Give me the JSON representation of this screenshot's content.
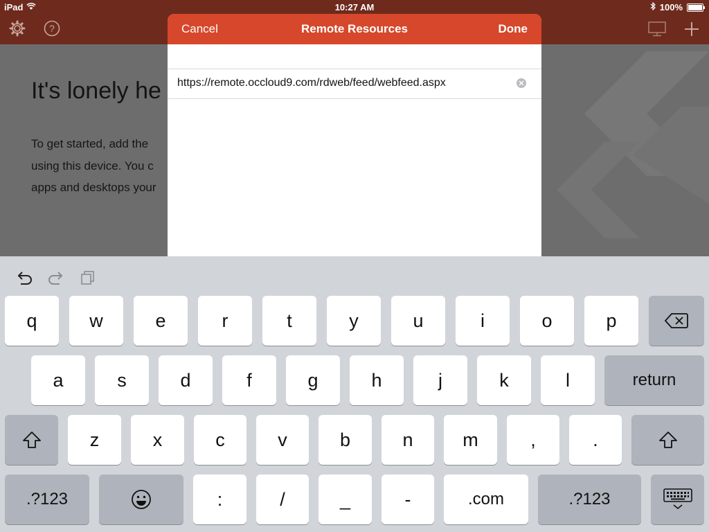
{
  "status_bar": {
    "device": "iPad",
    "time": "10:27 AM",
    "battery": "100%"
  },
  "app_header": {
    "icons": [
      "gear-icon",
      "help-icon",
      "desktop-icon",
      "plus-icon"
    ]
  },
  "background": {
    "heading": "It's lonely he",
    "lines": [
      "To get started, add the",
      "using this device. You c",
      "apps and desktops your"
    ]
  },
  "modal": {
    "cancel_label": "Cancel",
    "title": "Remote Resources",
    "done_label": "Done",
    "url_value": "https://remote.occloud9.com/rdweb/feed/webfeed.aspx"
  },
  "keyboard": {
    "tools": [
      "undo-icon",
      "redo-icon",
      "paste-icon"
    ],
    "row1": [
      "q",
      "w",
      "e",
      "r",
      "t",
      "y",
      "u",
      "i",
      "o",
      "p"
    ],
    "row2": [
      "a",
      "s",
      "d",
      "f",
      "g",
      "h",
      "j",
      "k",
      "l"
    ],
    "row3": [
      "z",
      "x",
      "c",
      "v",
      "b",
      "n",
      "m",
      ",",
      "."
    ],
    "return_label": "return",
    "numbers_label": ".?123",
    "colon": ":",
    "slash": "/",
    "underscore": "_",
    "dash": "-",
    "dotcom": ".com"
  },
  "colors": {
    "header_bg": "#6e2a1d",
    "modal_bar": "#d6472b",
    "keyboard_bg": "#d1d4d9"
  }
}
